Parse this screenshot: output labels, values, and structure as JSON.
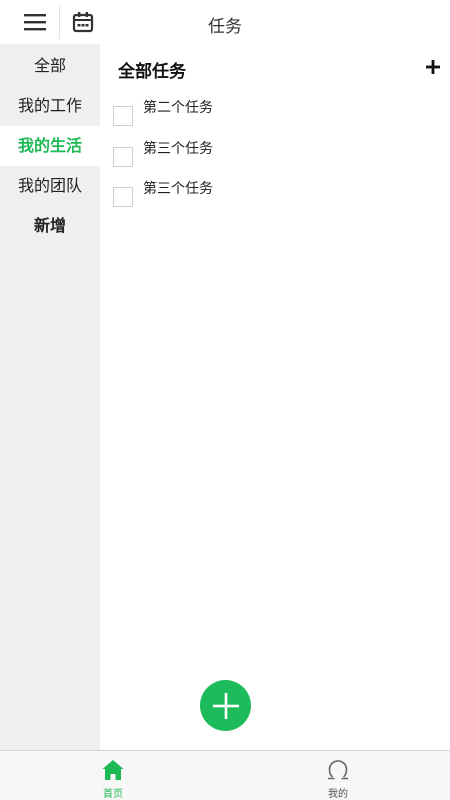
{
  "header": {
    "title": "任务"
  },
  "sidebar": {
    "items": [
      {
        "label": "全部"
      },
      {
        "label": "我的工作"
      },
      {
        "label": "我的生活"
      },
      {
        "label": "我的团队"
      },
      {
        "label": "新增"
      }
    ],
    "active_index": 2
  },
  "main": {
    "section_title": "全部任务",
    "tasks": [
      {
        "label": "第二个任务",
        "checked": false
      },
      {
        "label": "第三个任务",
        "checked": false
      },
      {
        "label": "第三个任务",
        "checked": false
      }
    ]
  },
  "tabbar": {
    "tabs": [
      {
        "label": "首页",
        "icon": "home-icon",
        "active": true
      },
      {
        "label": "我的",
        "icon": "profile-icon",
        "active": false
      }
    ]
  },
  "colors": {
    "accent": "#1db954",
    "fab": "#1dbb5b",
    "sidebar_bg": "#efefef"
  }
}
